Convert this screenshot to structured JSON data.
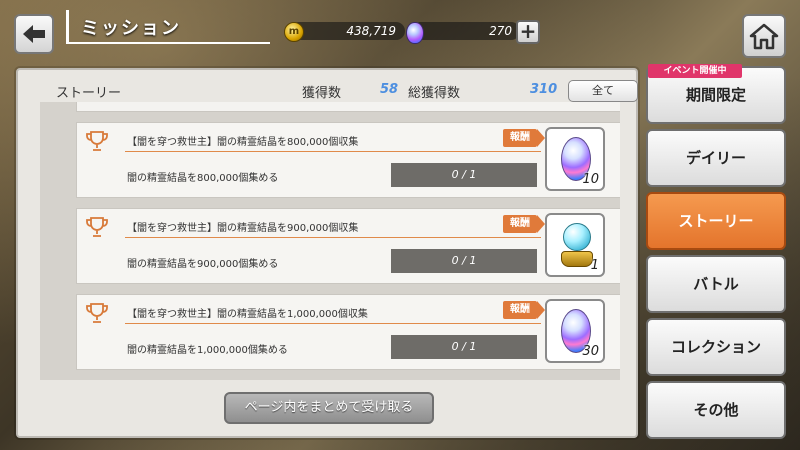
{
  "header": {
    "title": "ミッション",
    "gold_amount": "438,719",
    "gem_amount": "270",
    "coin_symbol": "m"
  },
  "panel": {
    "category": "ストーリー",
    "obtained_label": "獲得数",
    "obtained_value": "58",
    "total_label": "総獲得数",
    "total_value": "310",
    "filter_label": "全て"
  },
  "missions": [
    {
      "title": "【闇を穿つ救世主】闇の精霊結晶を800,000個収集",
      "reward_label": "報酬",
      "description": "闇の精霊結晶を800,000個集める",
      "progress": "0 / 1",
      "reward_icon": "rainbow-gem-icon",
      "reward_qty": "10"
    },
    {
      "title": "【闇を穿つ救世主】闇の精霊結晶を900,000個収集",
      "reward_label": "報酬",
      "description": "闇の精霊結晶を900,000個集める",
      "progress": "0 / 1",
      "reward_icon": "crystal-orb-icon",
      "reward_qty": "1"
    },
    {
      "title": "【闇を穿つ救世主】闇の精霊結晶を1,000,000個収集",
      "reward_label": "報酬",
      "description": "闇の精霊結晶を1,000,000個集める",
      "progress": "0 / 1",
      "reward_icon": "rainbow-gem-icon",
      "reward_qty": "30"
    }
  ],
  "collect_all_label": "ページ内をまとめて受け取る",
  "side_tabs": {
    "event_badge": "イベント開催中",
    "items": [
      {
        "label": "期間限定",
        "active": false
      },
      {
        "label": "デイリー",
        "active": false
      },
      {
        "label": "ストーリー",
        "active": true
      },
      {
        "label": "バトル",
        "active": false
      },
      {
        "label": "コレクション",
        "active": false
      },
      {
        "label": "その他",
        "active": false
      }
    ]
  },
  "colors": {
    "accent_orange": "#e4742c",
    "value_blue": "#4d8fe0",
    "event_pink": "#e0356a"
  }
}
